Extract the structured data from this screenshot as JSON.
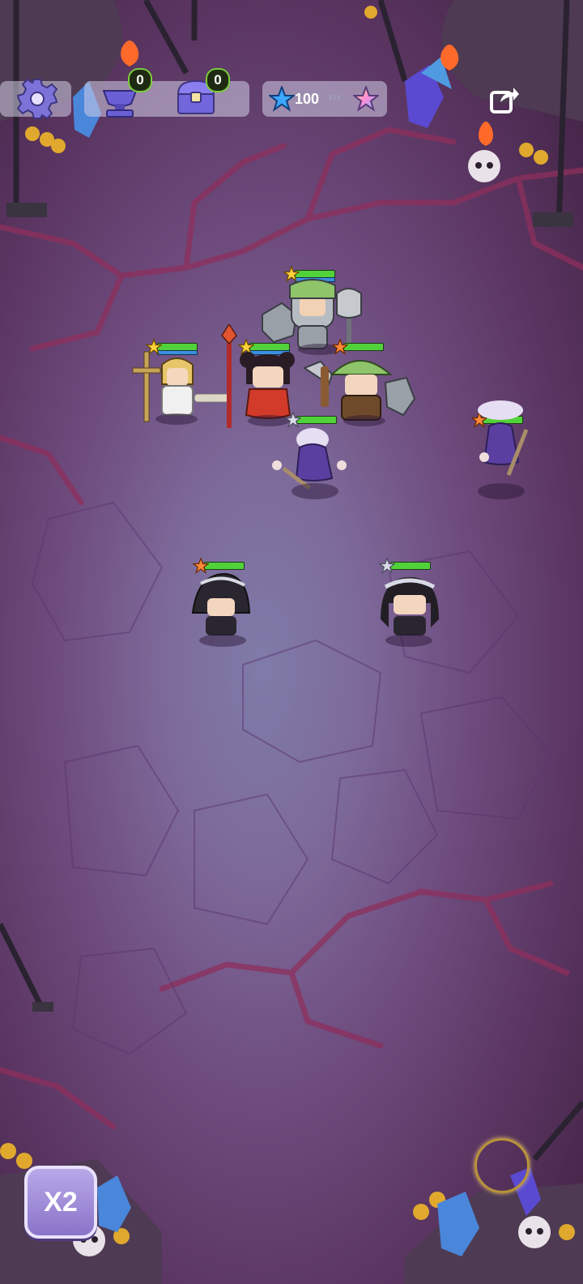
{
  "hud": {
    "trophy_count": "0",
    "chest_count": "0",
    "star_points": "100"
  },
  "controls": {
    "speed_label": "X2"
  },
  "icons": {
    "settings": "gear-icon",
    "trophy": "trophy-icon",
    "chest": "chest-icon",
    "star_blue": "star-icon",
    "star_rainbow": "star-icon",
    "share": "share-icon",
    "target": "target-ring-icon"
  },
  "units": [
    {
      "name": "knight",
      "star": "gold"
    },
    {
      "name": "priest",
      "star": "gold"
    },
    {
      "name": "monk",
      "star": "gold"
    },
    {
      "name": "ranger",
      "star": "orange"
    },
    {
      "name": "ghost-left",
      "star": "silver"
    },
    {
      "name": "ghost-right",
      "star": "orange"
    },
    {
      "name": "witch-left",
      "star": "orange"
    },
    {
      "name": "witch-right",
      "star": "silver"
    }
  ],
  "colors": {
    "hp": "#52d23a",
    "mp": "#3b8fe0",
    "accent": "#7acb3a"
  }
}
